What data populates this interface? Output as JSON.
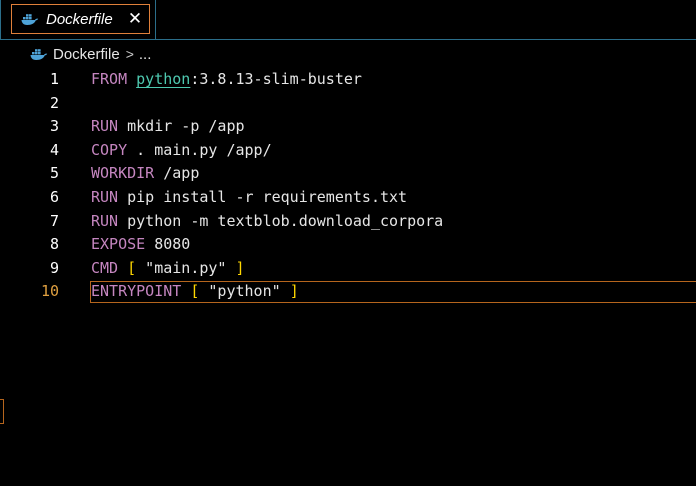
{
  "tab": {
    "label": "Dockerfile",
    "icon": "docker-icon",
    "close": "✕"
  },
  "breadcrumb": {
    "file": "Dockerfile",
    "separator": ">",
    "ellipsis": "..."
  },
  "editor": {
    "active_line": 10,
    "lines": [
      {
        "num": "1",
        "tokens": [
          [
            "kw",
            "FROM"
          ],
          [
            "",
            " "
          ],
          [
            "img",
            "python"
          ],
          [
            "",
            ":3.8.13-slim-buster"
          ]
        ]
      },
      {
        "num": "2",
        "tokens": []
      },
      {
        "num": "3",
        "tokens": [
          [
            "kw",
            "RUN"
          ],
          [
            "",
            " mkdir -p /app"
          ]
        ]
      },
      {
        "num": "4",
        "tokens": [
          [
            "kw",
            "COPY"
          ],
          [
            "",
            " . main.py /app/"
          ]
        ]
      },
      {
        "num": "5",
        "tokens": [
          [
            "kw",
            "WORKDIR"
          ],
          [
            "",
            " /app"
          ]
        ]
      },
      {
        "num": "6",
        "tokens": [
          [
            "kw",
            "RUN"
          ],
          [
            "",
            " pip install -r requirements.txt"
          ]
        ]
      },
      {
        "num": "7",
        "tokens": [
          [
            "kw",
            "RUN"
          ],
          [
            "",
            " python -m textblob.download_corpora"
          ]
        ]
      },
      {
        "num": "8",
        "tokens": [
          [
            "kw",
            "EXPOSE"
          ],
          [
            "",
            " 8080"
          ]
        ]
      },
      {
        "num": "9",
        "tokens": [
          [
            "kw",
            "CMD"
          ],
          [
            "",
            " "
          ],
          [
            "br",
            "["
          ],
          [
            "str",
            " \"main.py\" "
          ],
          [
            "br",
            "]"
          ]
        ]
      },
      {
        "num": "10",
        "tokens": [
          [
            "kw",
            "ENTRYPOINT"
          ],
          [
            "",
            " "
          ],
          [
            "br",
            "["
          ],
          [
            "str",
            " \"python\" "
          ],
          [
            "br",
            "]"
          ]
        ]
      }
    ]
  },
  "colors": {
    "keyword": "#c586c0",
    "image": "#4ec9b0",
    "bracket": "#ffd700",
    "tab_border": "#e0803a",
    "active_line_number": "#e0a040"
  }
}
